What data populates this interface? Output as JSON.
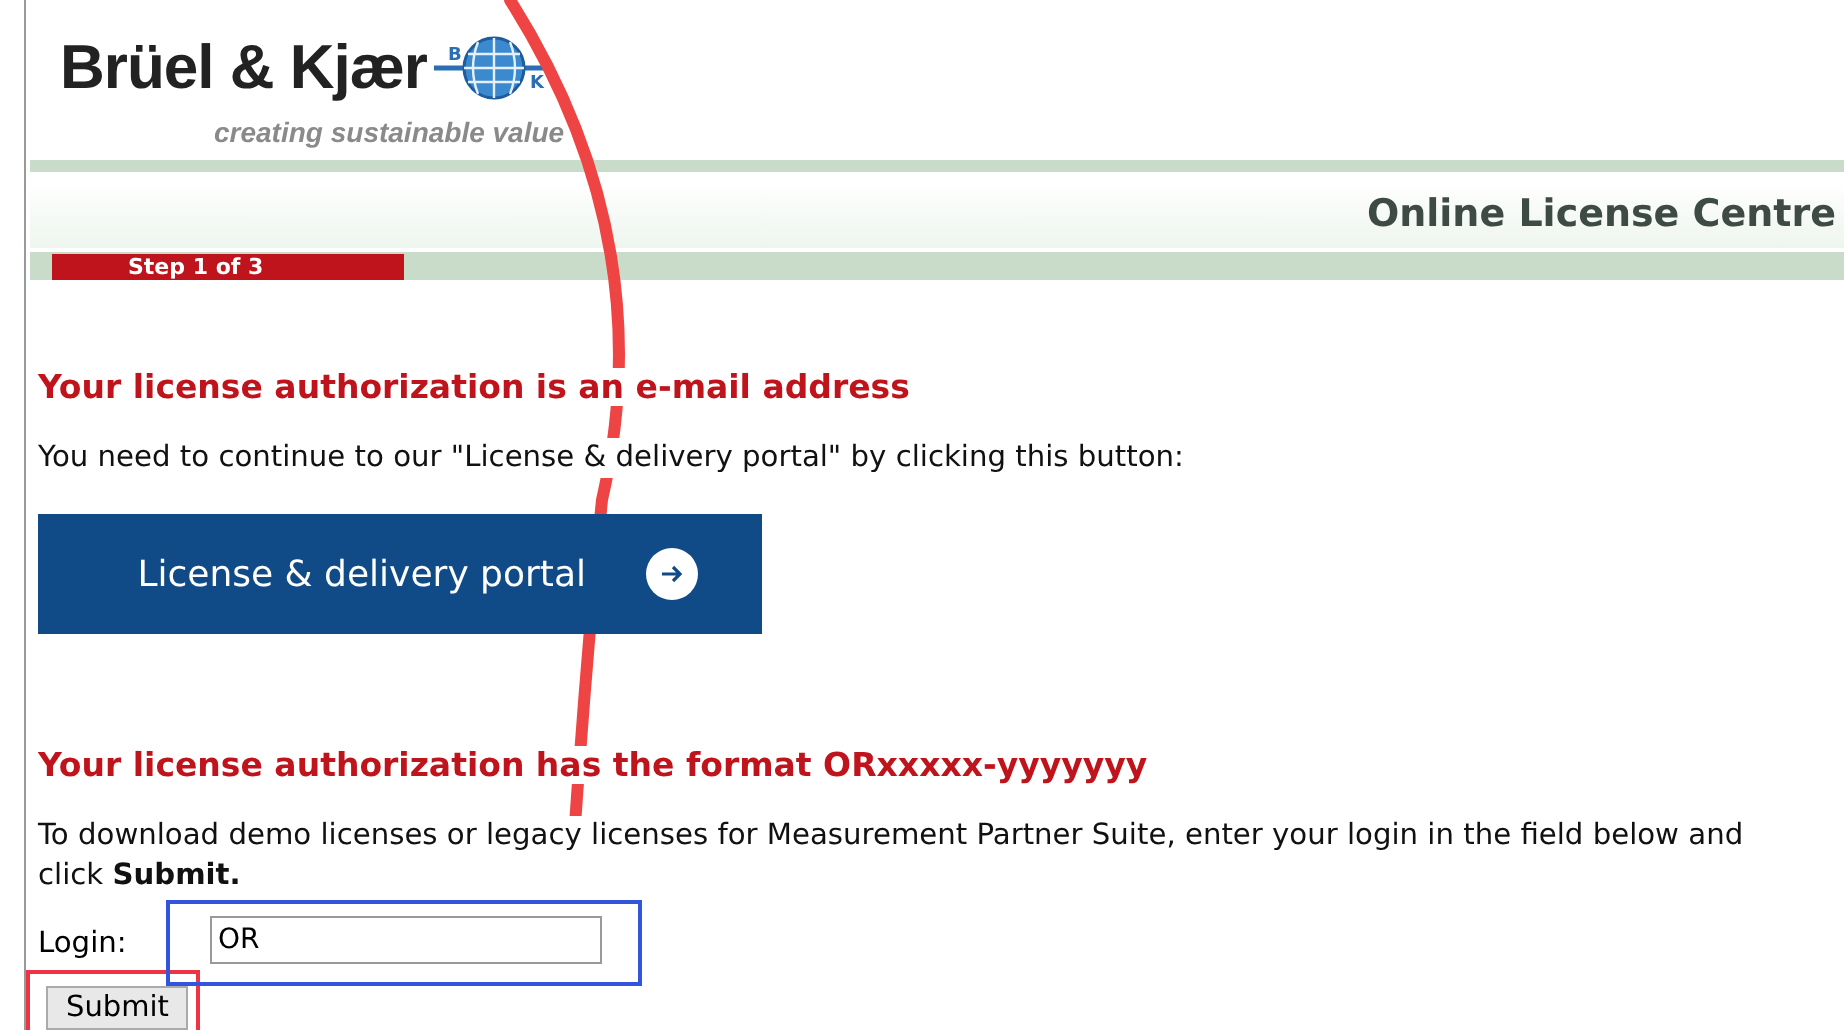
{
  "logo": {
    "name": "Brüel & Kjær",
    "letters": [
      "B",
      "K"
    ],
    "tagline": "creating sustainable value"
  },
  "header": {
    "title": "Online License Centre",
    "step": "Step 1 of 3"
  },
  "sections": [
    {
      "heading": "Your license authorization is an e-mail address",
      "text": "You need to continue to our \"License & delivery portal\" by clicking this button:",
      "kind": "portal",
      "button": "License & delivery portal"
    },
    {
      "heading": "Your license authorization has the format ORxxxxx-yyyyyyy",
      "text": "To download demo licenses or legacy licenses for Measurement Partner Suite, enter your login in the field below and click **Submit.**",
      "kind": "login",
      "label": "Login:",
      "value": "OR",
      "button": "Submit"
    }
  ]
}
